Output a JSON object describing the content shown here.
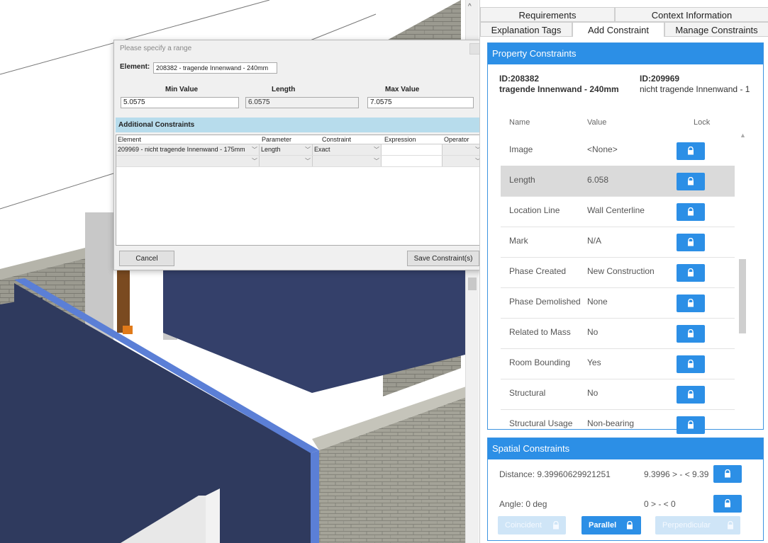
{
  "dialog": {
    "title": "Please specify a range",
    "element_label": "Element:",
    "element_value": "208382 - tragende Innenwand - 240mm",
    "min_label": "Min Value",
    "param_label": "Length",
    "max_label": "Max Value",
    "min_value": "5.0575",
    "param_value": "6.0575",
    "max_value": "7.0575",
    "additional_title": "Additional Constraints",
    "grid_headers": [
      "Element",
      "Parameter",
      "Constraint",
      "Expression",
      "Operator"
    ],
    "grid_row": {
      "element": "209969 - nicht tragende Innenwand - 175mm",
      "parameter": "Length",
      "constraint": "Exact",
      "expression": "",
      "operator": ""
    },
    "cancel_label": "Cancel",
    "save_label": "Save Constraint(s)"
  },
  "panel": {
    "tabs_top": [
      "Requirements",
      "Context Information"
    ],
    "tabs_bottom": [
      "Explanation Tags",
      "Add Constraint",
      "Manage Constraints"
    ],
    "active_tab": "Add Constraint",
    "property_title": "Property Constraints",
    "id_left": "ID:208382",
    "name_left": "tragende Innenwand - 240mm",
    "id_right": "ID:209969",
    "name_right": "nicht tragende Innenwand - 1",
    "columns": [
      "Name",
      "Value",
      "Lock"
    ],
    "rows": [
      {
        "name": "Image",
        "value": "<None>"
      },
      {
        "name": "Length",
        "value": "6.058",
        "selected": true
      },
      {
        "name": "Location Line",
        "value": "Wall Centerline"
      },
      {
        "name": "Mark",
        "value": "N/A"
      },
      {
        "name": "Phase Created",
        "value": "New Construction"
      },
      {
        "name": "Phase Demolished",
        "value": "None"
      },
      {
        "name": "Related to Mass",
        "value": "No"
      },
      {
        "name": "Room Bounding",
        "value": "Yes"
      },
      {
        "name": "Structural",
        "value": "No"
      },
      {
        "name": "Structural Usage",
        "value": "Non-bearing"
      }
    ],
    "spatial_title": "Spatial Constraints",
    "distance_text": "Distance: 9.39960629921251",
    "distance_range": "9.3996 > - < 9.39",
    "angle_text": "Angle: 0 deg",
    "angle_range": "0 > - < 0",
    "btn_coincident": "Coincident",
    "btn_parallel": "Parallel",
    "btn_perpendicular": "Perpendicular"
  },
  "colors": {
    "accent": "#2c8fe6",
    "dialog_header": "#b7dcec",
    "wall_blue": "#5b7fd6",
    "floor_dark": "#2f3a5e"
  },
  "icons": [
    "lock-icon",
    "scroll-up-icon",
    "scroll-down-icon",
    "chevron-down-icon",
    "close-icon"
  ]
}
